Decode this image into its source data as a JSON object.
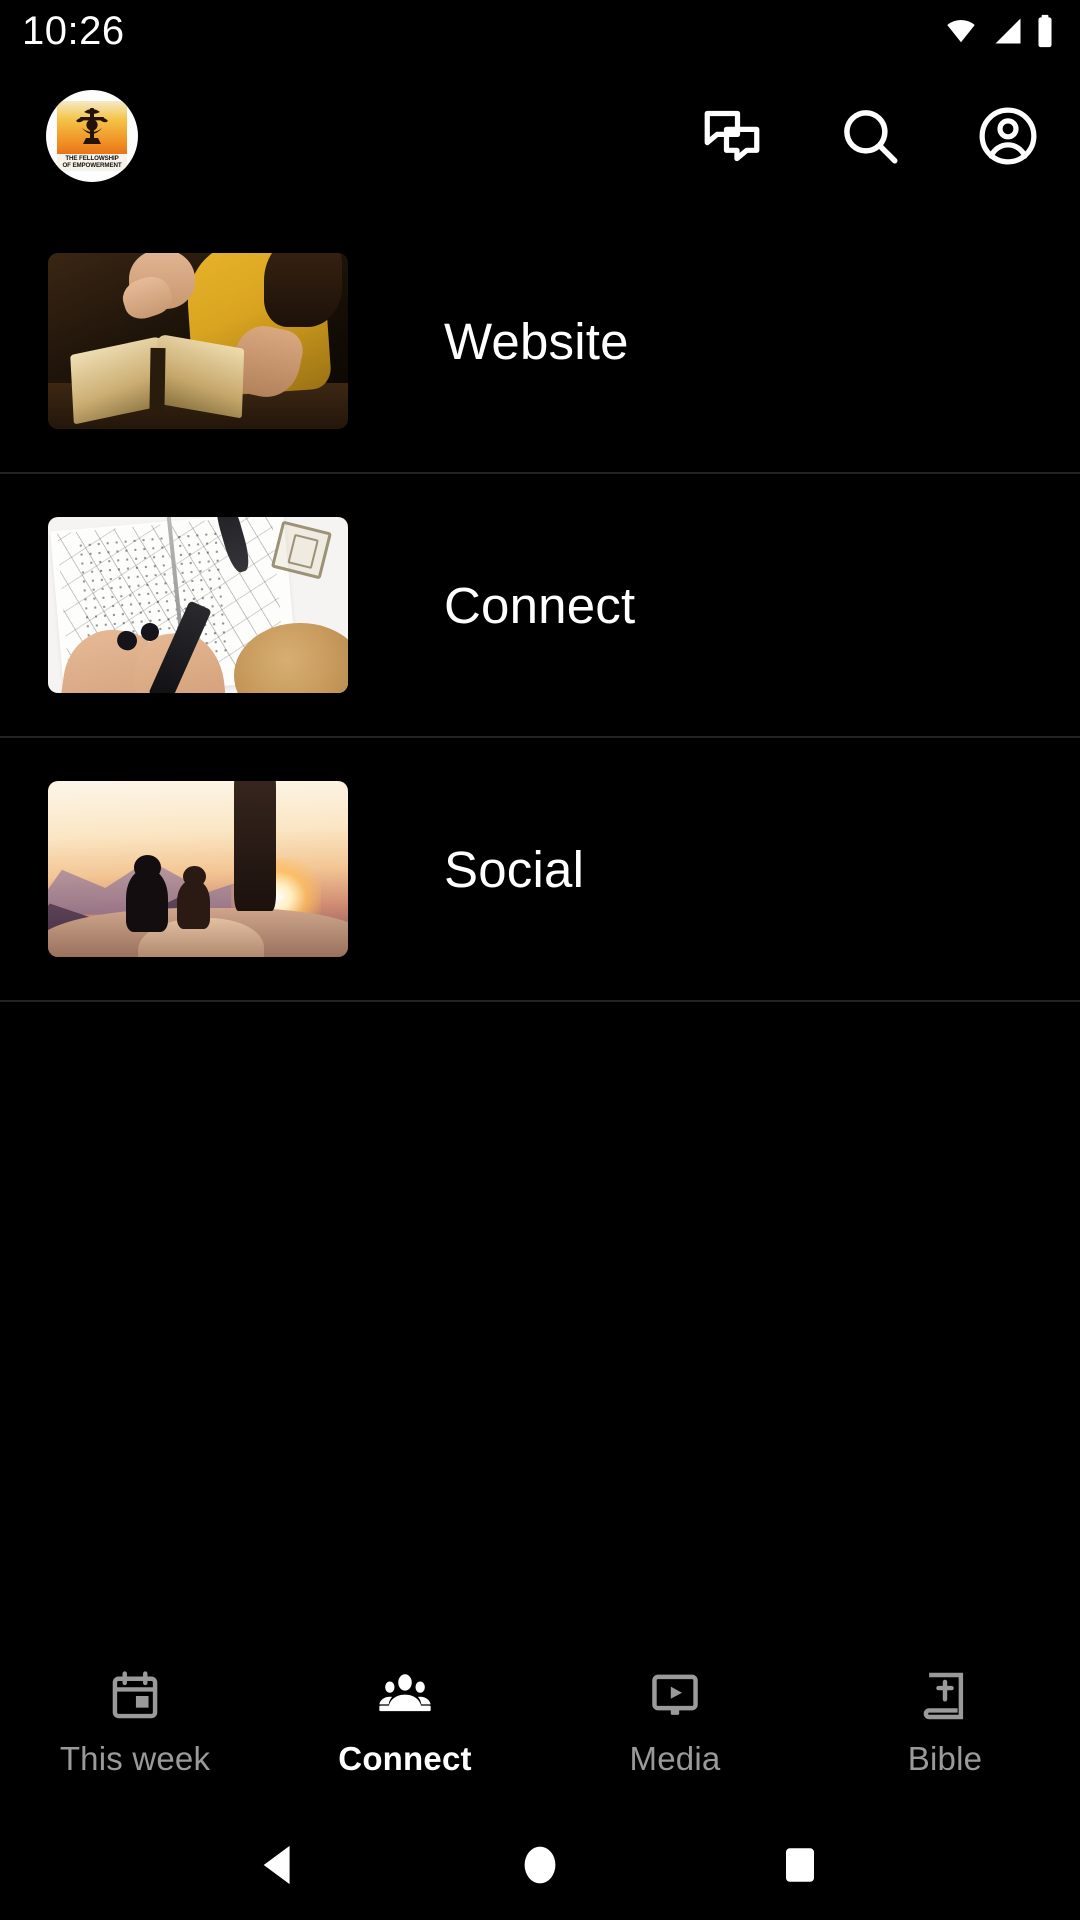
{
  "status_bar": {
    "time": "10:26",
    "icons": [
      "wifi-icon",
      "cellular-signal-icon",
      "battery-icon"
    ]
  },
  "header": {
    "logo": {
      "name": "app-logo",
      "caption_line1": "THE FELLOWSHIP",
      "caption_line2": "OF EMPOWERMENT",
      "background_colors": [
        "#f4c447",
        "#ef8b22",
        "#c24a08"
      ]
    },
    "actions": [
      {
        "name": "messages-icon",
        "label": "Messages"
      },
      {
        "name": "search-icon",
        "label": "Search"
      },
      {
        "name": "account-circle-icon",
        "label": "Account"
      }
    ]
  },
  "main": {
    "items": [
      {
        "label": "Website",
        "thumbnail": "person-reading-bible-image"
      },
      {
        "label": "Connect",
        "thumbnail": "hands-writing-planner-image"
      },
      {
        "label": "Social",
        "thumbnail": "mountain-sunset-silhouettes-image"
      }
    ]
  },
  "bottom_nav": {
    "active_index": 1,
    "items": [
      {
        "label": "This week",
        "icon": "calendar-icon",
        "active": false
      },
      {
        "label": "Connect",
        "icon": "people-group-icon",
        "active": true
      },
      {
        "label": "Media",
        "icon": "video-player-icon",
        "active": false
      },
      {
        "label": "Bible",
        "icon": "bible-book-icon",
        "active": false
      }
    ],
    "active_color": "#ffffff",
    "inactive_color": "#9a9a9a"
  },
  "system_nav": {
    "buttons": [
      {
        "name": "back-button",
        "icon": "triangle-back-icon"
      },
      {
        "name": "home-button",
        "icon": "circle-home-icon"
      },
      {
        "name": "recents-button",
        "icon": "square-recents-icon"
      }
    ]
  }
}
